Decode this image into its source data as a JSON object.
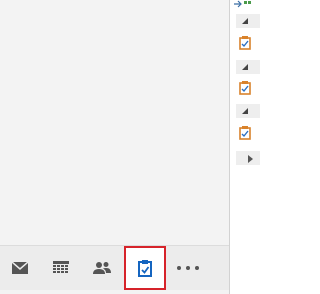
{
  "navigation": {
    "items": [
      {
        "name": "mail-icon",
        "selected": false
      },
      {
        "name": "calendar-icon",
        "selected": false
      },
      {
        "name": "people-icon",
        "selected": false
      },
      {
        "name": "tasks-icon",
        "selected": true
      },
      {
        "name": "more-icon",
        "selected": false
      }
    ],
    "selected_outline_color": "#d6232a",
    "icon_color": "#555555",
    "selected_icon_color": "#1565c0"
  },
  "task_panel": {
    "groups": [
      {
        "expanded": true,
        "has_task": true
      },
      {
        "expanded": true,
        "has_task": true
      },
      {
        "expanded": true,
        "has_task": true
      },
      {
        "expanded": false,
        "has_task": false
      }
    ],
    "task_icon_color": "#d9822b"
  }
}
